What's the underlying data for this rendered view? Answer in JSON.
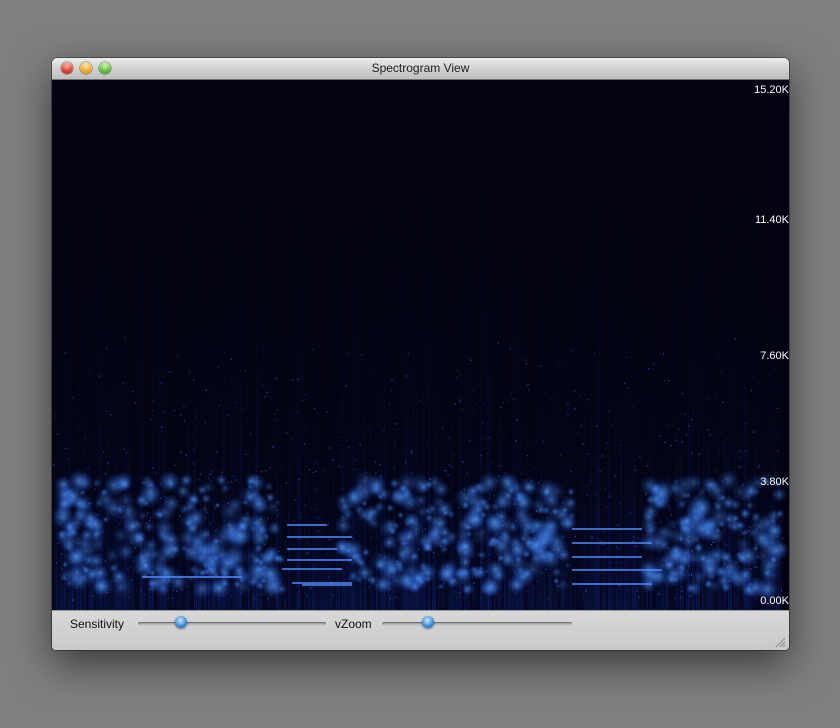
{
  "window": {
    "title": "Spectrogram View"
  },
  "spectrogram": {
    "y_axis_labels": [
      "15.20K",
      "11.40K",
      "7.60K",
      "3.80K",
      "0.00K"
    ],
    "y_axis_values": [
      15.2,
      11.4,
      7.6,
      3.8,
      0.0
    ],
    "y_unit": "K",
    "colors": {
      "background": "#030312",
      "energy_low": "#0b1a66",
      "energy_mid": "#1f4fd6",
      "energy_high": "#56a8ff"
    }
  },
  "controls": {
    "sensitivity_label": "Sensitivity",
    "sensitivity_value": 0.23,
    "vzoom_label": "vZoom",
    "vzoom_value": 0.24
  },
  "colors": {
    "slider_knob": "#3d8fe0",
    "titlebar": "#d4d4d4"
  }
}
